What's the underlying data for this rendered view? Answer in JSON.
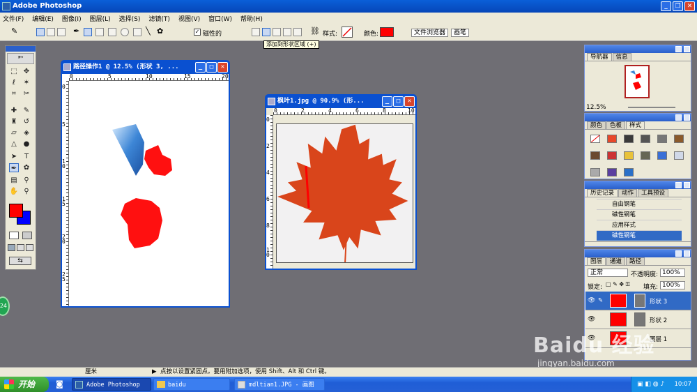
{
  "app": {
    "title": "Adobe Photoshop"
  },
  "menu": [
    "文件(F)",
    "编辑(E)",
    "图像(I)",
    "图层(L)",
    "选择(S)",
    "滤镜(T)",
    "视图(V)",
    "窗口(W)",
    "帮助(H)"
  ],
  "options": {
    "magnetic_label": "磁性的",
    "style_label": "样式:",
    "color_label": "颜色:",
    "shape_color": "#ff0000",
    "tab_file_browser": "文件浏览器",
    "tab_brushes": "画笔",
    "tooltip": "添加到形状区域 (+)"
  },
  "doc1": {
    "title": "路径操作1 @ 12.5% (形状 3, ...",
    "ruler_h": [
      "0",
      "5",
      "10",
      "15",
      "20"
    ],
    "ruler_v": [
      "0",
      "5",
      "1 0",
      "1 5",
      "2 0",
      "2 5"
    ]
  },
  "doc2": {
    "title": "枫叶1.jpg @ 90.9% (形...",
    "ruler_h": [
      "0",
      "2",
      "4",
      "6",
      "8",
      "10"
    ],
    "ruler_v": [
      "0",
      "2",
      "4",
      "6",
      "8",
      "10"
    ]
  },
  "navigator": {
    "tabs": [
      "导航器",
      "信息"
    ],
    "zoom": "12.5%"
  },
  "swatches_panel": {
    "tabs": [
      "颜色",
      "色板",
      "样式"
    ]
  },
  "history": {
    "tabs": [
      "历史记录",
      "动作",
      "工具预设"
    ],
    "items": [
      "自由钢笔",
      "磁性钢笔",
      "应用样式",
      "磁性钢笔"
    ],
    "selected_index": 3
  },
  "layers": {
    "tabs": [
      "图层",
      "通道",
      "路径"
    ],
    "blend_mode": "正常",
    "opacity_label": "不透明度:",
    "opacity": "100%",
    "lock_label": "锁定:",
    "fill_label": "填充:",
    "fill": "100%",
    "items": [
      "形状 3",
      "形状 2",
      "图层 1"
    ]
  },
  "status": {
    "unit": "厘米",
    "hint": "点按以设置紧固点。要用附加选项，使用 Shift、Alt 和 Ctrl 键。"
  },
  "taskbar": {
    "start": "开始",
    "items": [
      "Adobe Photoshop",
      "baidu",
      "mdltian1.JPG - 画图"
    ],
    "clock": "10:07"
  },
  "watermark": {
    "brand": "Baidu 经验",
    "url": "jingyan.baidu.com"
  },
  "badge": "24"
}
